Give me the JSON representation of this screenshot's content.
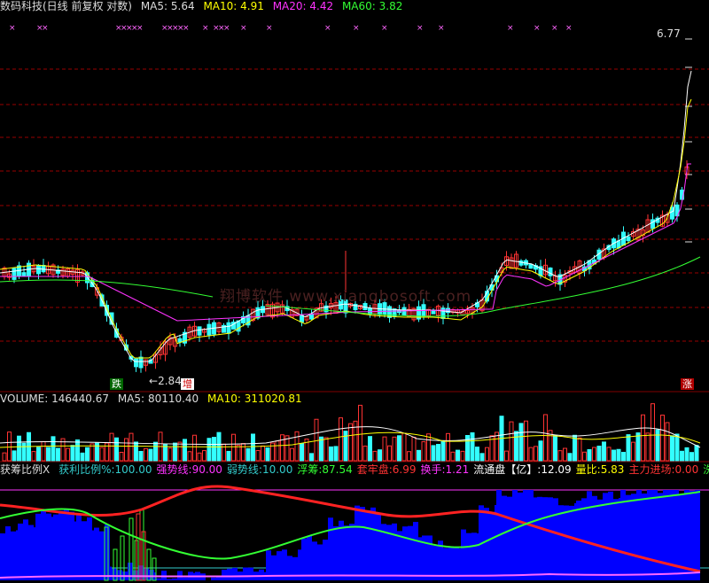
{
  "header": {
    "title": "数码科技(日线 前复权 对数)",
    "ma5_label": "MA5:",
    "ma5_value": "5.64",
    "ma10_label": "MA10:",
    "ma10_value": "4.91",
    "ma20_label": "MA20:",
    "ma20_value": "4.42",
    "ma60_label": "MA60:",
    "ma60_value": "3.82"
  },
  "main_chart": {
    "high_label": "6.77",
    "low_label": "2.84",
    "watermark": "翔博软件 www.xiangbosoft.com",
    "tags": [
      "跌",
      "增",
      "涨"
    ]
  },
  "volume_panel": {
    "volume_label": "VOLUME:",
    "volume_value": "146440.67",
    "ma5_label": "MA5:",
    "ma5_value": "80110.40",
    "ma10_label": "MA10:",
    "ma10_value": "311020.81"
  },
  "indicator_panel": {
    "name": "获筹比例X",
    "items": [
      {
        "label": "获利比例%:",
        "value": "100.00",
        "color": "#33cccc"
      },
      {
        "label": "强势线:",
        "value": "90.00",
        "color": "#ff33ff"
      },
      {
        "label": "弱势线:",
        "value": "10.00",
        "color": "#33cccc"
      },
      {
        "label": "浮筹:",
        "value": "87.54",
        "color": "#33ff33"
      },
      {
        "label": "套牢盘:",
        "value": "6.99",
        "color": "#ff3333"
      },
      {
        "label": "换手:",
        "value": "1.21",
        "color": "#ff33ff"
      },
      {
        "label": "流通盘【亿】:",
        "value": "12.09",
        "color": "#ffffff"
      },
      {
        "label": "量比:",
        "value": "5.83",
        "color": "#ffff00"
      },
      {
        "label": "主力进场:",
        "value": "0.00",
        "color": "#ff3333"
      },
      {
        "label": "洗",
        "value": "",
        "color": "#33ff33"
      }
    ]
  },
  "colors": {
    "up": "#ff3333",
    "down": "#33ffff",
    "ma5": "#ffffff",
    "ma10": "#ffff00",
    "ma20": "#ff33ff",
    "ma60": "#33ff33",
    "grid": "#990000"
  }
}
